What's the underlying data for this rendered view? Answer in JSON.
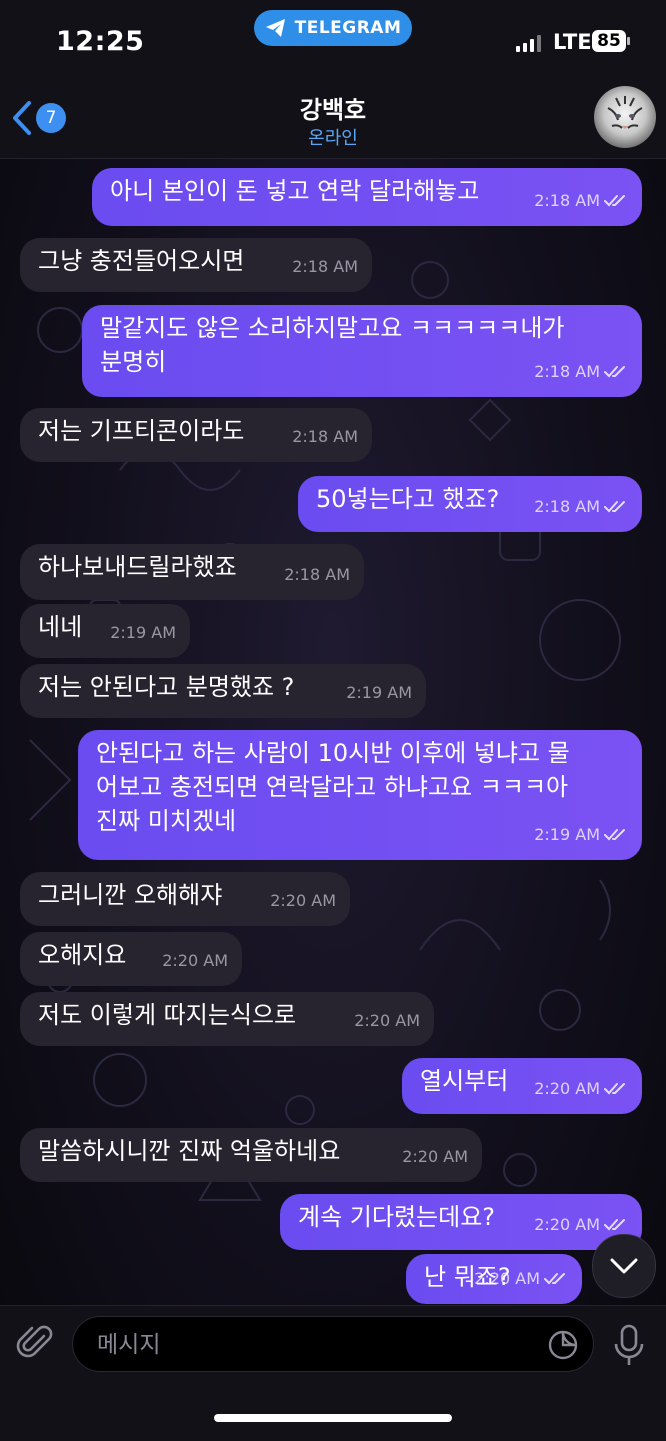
{
  "status_bar": {
    "time": "12:25",
    "telegram_label": "TELEGRAM",
    "network": "LTE",
    "battery": "85"
  },
  "header": {
    "back_badge": "7",
    "name": "강백호",
    "status": "온라인"
  },
  "messages": [
    {
      "dir": "out",
      "text": "아니 본인이 돈 넣고 연락 달라해놓고",
      "time": "2:18 AM"
    },
    {
      "dir": "in",
      "text": "그냥 충전들어오시면",
      "time": "2:18 AM"
    },
    {
      "dir": "out",
      "text": "말같지도 않은 소리하지말고요 ㅋㅋㅋㅋㅋ내가\n분명히",
      "time": "2:18 AM"
    },
    {
      "dir": "in",
      "text": "저는 기프티콘이라도",
      "time": "2:18 AM"
    },
    {
      "dir": "out",
      "text": "50넣는다고 했죠?",
      "time": "2:18 AM"
    },
    {
      "dir": "in",
      "text": "하나보내드릴라했죠",
      "time": "2:18 AM"
    },
    {
      "dir": "in",
      "text": "네네",
      "time": "2:19 AM"
    },
    {
      "dir": "in",
      "text": "저는 안된다고 분명했죠 ?",
      "time": "2:19 AM"
    },
    {
      "dir": "out",
      "text": "안된다고 하는 사람이 10시반 이후에 넣냐고 물\n어보고 충전되면 연락달라고 하냐고요 ㅋㅋㅋ아\n진짜 미치겠네",
      "time": "2:19 AM"
    },
    {
      "dir": "in",
      "text": "그러니깐 오해해쟈",
      "time": "2:20 AM"
    },
    {
      "dir": "in",
      "text": "오해지요",
      "time": "2:20 AM"
    },
    {
      "dir": "in",
      "text": "저도 이렇게 따지는식으로",
      "time": "2:20 AM"
    },
    {
      "dir": "out",
      "text": "열시부터",
      "time": "2:20 AM"
    },
    {
      "dir": "in",
      "text": "말씀하시니깐 진짜 억울하네요",
      "time": "2:20 AM"
    },
    {
      "dir": "out",
      "text": "계속 기다렸는데요?",
      "time": "2:20 AM"
    },
    {
      "dir": "out",
      "text": "난 뭐죠?",
      "time": "2:20 AM"
    }
  ],
  "input": {
    "placeholder": "메시지"
  },
  "colors": {
    "accent": "#3d8ff2",
    "outgoing": "#6f4ff2",
    "incoming": "#27232f"
  }
}
